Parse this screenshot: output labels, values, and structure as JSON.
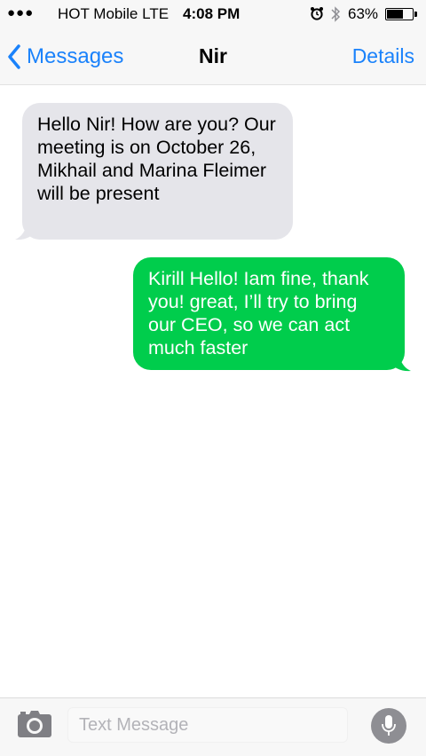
{
  "status_bar": {
    "carrier": "HOT Mobile",
    "network": "LTE",
    "time": "4:08 PM",
    "battery_percent": "63%",
    "battery_level": 0.63,
    "icons": [
      "signal-dots-icon",
      "alarm-clock-icon",
      "bluetooth-icon",
      "battery-icon"
    ]
  },
  "nav": {
    "back_label": "Messages",
    "title": "Nir",
    "details_label": "Details"
  },
  "messages": [
    {
      "direction": "incoming",
      "text": "Hello Nir! How are you? Our meeting is on October 26, Mikhail and Marina Fleimer will be present"
    },
    {
      "direction": "outgoing",
      "text": "Kirill Hello! Iam fine, thank you! great, I’ll try to bring our CEO, so we can act much faster"
    }
  ],
  "input_bar": {
    "placeholder": "Text Message",
    "value": "",
    "icons": [
      "camera-icon",
      "microphone-icon"
    ]
  },
  "colors": {
    "accent": "#1a82fb",
    "incoming_bubble": "#e5e5ea",
    "outgoing_bubble": "#00cd4c"
  }
}
